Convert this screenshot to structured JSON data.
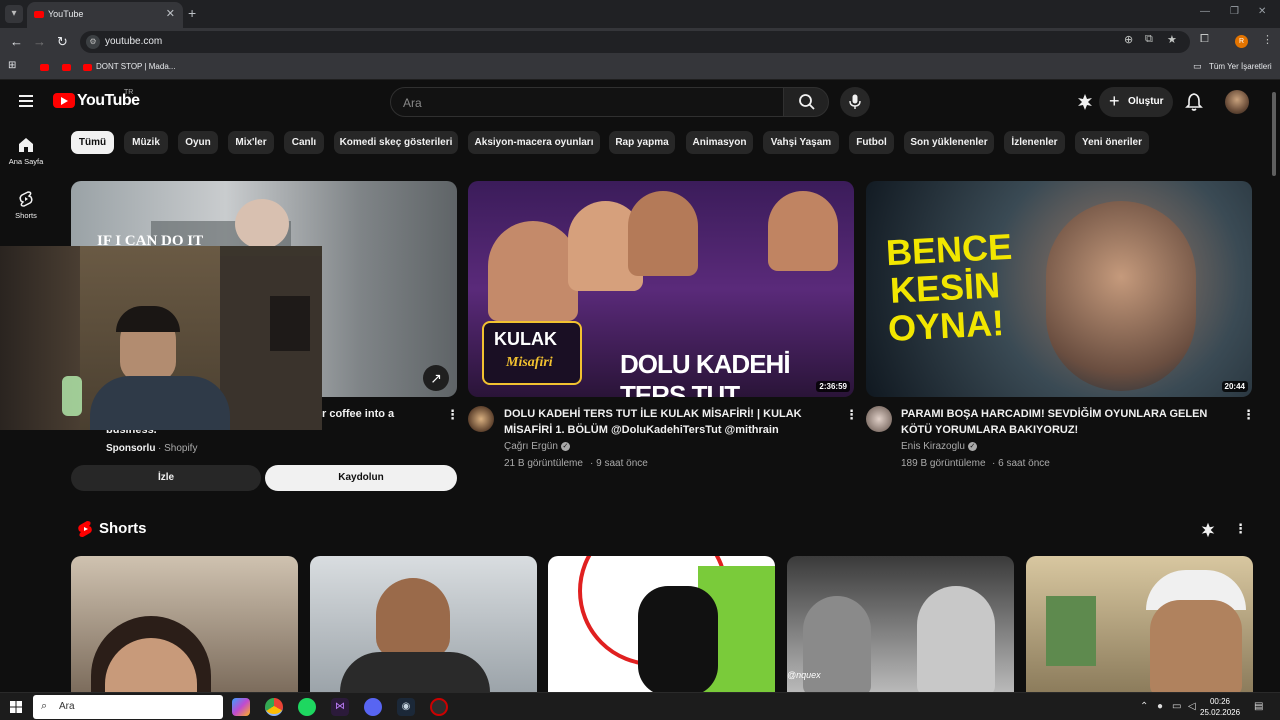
{
  "browser": {
    "tab_title": "YouTube",
    "url": "youtube.com",
    "bookmarks": [
      {
        "label": ""
      },
      {
        "label": ""
      },
      {
        "label": "DONT STOP | Mada..."
      }
    ],
    "all_bookmarks": "Tüm Yer İşaretleri",
    "profile_initial": "R"
  },
  "header": {
    "logo_text": "YouTube",
    "country": "TR",
    "search_placeholder": "Ara",
    "create_label": "Oluştur"
  },
  "sidebar": {
    "items": [
      {
        "label": "Ana Sayfa",
        "icon": "home-icon"
      },
      {
        "label": "Shorts",
        "icon": "shorts-icon"
      }
    ]
  },
  "chips": [
    {
      "label": "Tümü",
      "active": true
    },
    {
      "label": "Müzik"
    },
    {
      "label": "Oyun"
    },
    {
      "label": "Mix'ler"
    },
    {
      "label": "Canlı"
    },
    {
      "label": "Komedi skeç gösterileri"
    },
    {
      "label": "Aksiyon-macera oyunları"
    },
    {
      "label": "Rap yapma"
    },
    {
      "label": "Animasyon"
    },
    {
      "label": "Vahşi Yaşam"
    },
    {
      "label": "Futbol"
    },
    {
      "label": "Son yüklenenler"
    },
    {
      "label": "İzlenenler"
    },
    {
      "label": "Yeni öneriler"
    }
  ],
  "videos": [
    {
      "thumb_text": "IF I CAN DO IT",
      "title_line1": "r coffee into a",
      "title_line2": "business.",
      "sponsored": "Sponsorlu",
      "advertiser": "· Shopify",
      "watch_label": "İzle",
      "subscribe_label": "Kaydolun"
    },
    {
      "title": "DOLU KADEHİ TERS TUT İLE KULAK MİSAFİRİ! | KULAK MİSAFİRİ 1. BÖLÜM @DoluKadehiTersTut @mithrain",
      "channel": "Çağrı Ergün",
      "views": "21 B görüntüleme",
      "age": "· 9 saat önce",
      "duration": "2:36:59",
      "thumb_logo_top": "KULAK",
      "thumb_logo_bottom": "Misafiri",
      "thumb_caption": "DOLU KADEHİ TERS TUT"
    },
    {
      "title": "PARAMI BOŞA HARCADIM! SEVDİĞİM OYUNLARA GELEN KÖTÜ YORUMLARA BAKIYORUZ!",
      "channel": "Enis Kirazoglu",
      "views": "189 B görüntüleme",
      "age": "· 6 saat önce",
      "duration": "20:44",
      "thumb_caption_1": "BENCE",
      "thumb_caption_2": "KESİN",
      "thumb_caption_3": "OYNA!"
    }
  ],
  "shorts": {
    "title": "Shorts",
    "overlay_text": "@nquex"
  },
  "taskbar": {
    "search_label": "Ara",
    "time": "00:26",
    "date": "25.02.2026"
  },
  "colors": {
    "background": "#0f0f0f",
    "brand_red": "#ff0000",
    "chip_bg": "#272727",
    "chip_active_bg": "#f1f1f1"
  }
}
